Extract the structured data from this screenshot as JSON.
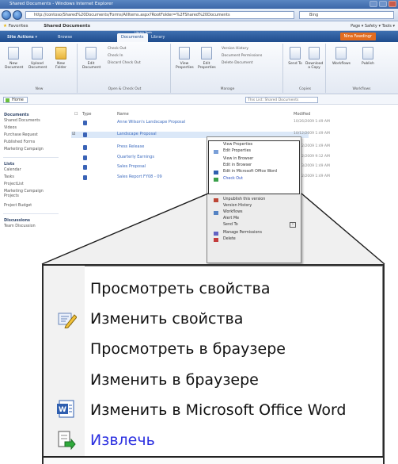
{
  "browser": {
    "title": "Shared Documents - Windows Internet Explorer",
    "address": "http://contoso/Shared%20Documents/Forms/AllItems.aspx?RootFolder=%2FShared%20Documents",
    "search_placeholder": "Bing",
    "favorites_label": "Favorites",
    "tab_label": "Shared Documents",
    "commands": "Page ▾  Safety ▾  Tools ▾"
  },
  "ribbon": {
    "site_actions": "Site Actions ▾",
    "tabs": [
      "Browse",
      "Documents",
      "Library"
    ],
    "context_label": "Library Tools",
    "user_button": "Nina Fawdingr",
    "my_sharepoint": "My SharePoint ▾",
    "groups": {
      "new": {
        "label": "New",
        "buttons": [
          "New Document",
          "Upload Document",
          "New Folder"
        ]
      },
      "open_checkout": {
        "label": "Open & Check Out",
        "buttons": [
          "Edit Document"
        ],
        "small": [
          "Check Out",
          "Check In",
          "Discard Check Out"
        ]
      },
      "manage": {
        "label": "Manage",
        "buttons": [
          "View Properties",
          "Edit Properties"
        ],
        "small": [
          "Version History",
          "Document Permissions",
          "Delete Document"
        ]
      },
      "copies": {
        "label": "Copies",
        "buttons": [
          "Send To",
          "Download a Copy"
        ]
      },
      "workflows": {
        "label": "Workflows",
        "buttons": [
          "Workflows",
          "Publish"
        ]
      }
    }
  },
  "page": {
    "home_label": "Home",
    "list_search": "This List: Shared Documents",
    "quick_launch": {
      "documents_heading": "Documents",
      "documents": [
        "Shared Documents",
        "Videos",
        "Purchase Request",
        "Published Forms",
        "Marketing Campaign"
      ],
      "lists_heading": "Lists",
      "lists": [
        "Calendar",
        "Tasks",
        "ProjectList",
        "Marketing Campaign Projects",
        "Project Budget"
      ],
      "discussions_heading": "Discussions",
      "discussions": [
        "Team Discussion"
      ]
    },
    "columns": [
      "Type",
      "Name",
      "Modified"
    ],
    "rows": [
      {
        "name": "Anne Wilson's Landscape Proposal",
        "modified": "10/26/2009 1:49 AM"
      },
      {
        "name": "Landscape Proposal",
        "modified": "10/12/2009 1:49 AM"
      },
      {
        "name": "Press Release",
        "modified": "10/12/2009 1:49 AM"
      },
      {
        "name": "Quarterly Earnings",
        "modified": "10/12/2009 9:12 AM"
      },
      {
        "name": "Sales Proposal",
        "modified": "10/13/2009 1:49 AM"
      },
      {
        "name": "Sales Report FY08 - 09",
        "modified": "10/12/2009 1:49 AM"
      }
    ]
  },
  "small_menu": {
    "items": [
      "View Properties",
      "Edit Properties",
      "View in Browser",
      "Edit in Browser",
      "Edit in Microsoft Office Word",
      "Check Out",
      "Unpublish this version",
      "Version History",
      "Workflows",
      "Alert Me",
      "Send To",
      "Manage Permissions",
      "Delete"
    ]
  },
  "callout_menu": {
    "items": [
      {
        "label": "Просмотреть свойства",
        "icon": ""
      },
      {
        "label": "Изменить свойства",
        "icon": "edit-properties-icon"
      },
      {
        "label": "Просмотреть в браузере",
        "icon": ""
      },
      {
        "label": "Изменить в браузере",
        "icon": ""
      },
      {
        "label": "Изменить в Microsoft Office Word",
        "icon": "word-icon"
      },
      {
        "label": "Извлечь",
        "icon": "check-out-icon"
      }
    ],
    "accent_color": "#2a2ee0"
  }
}
